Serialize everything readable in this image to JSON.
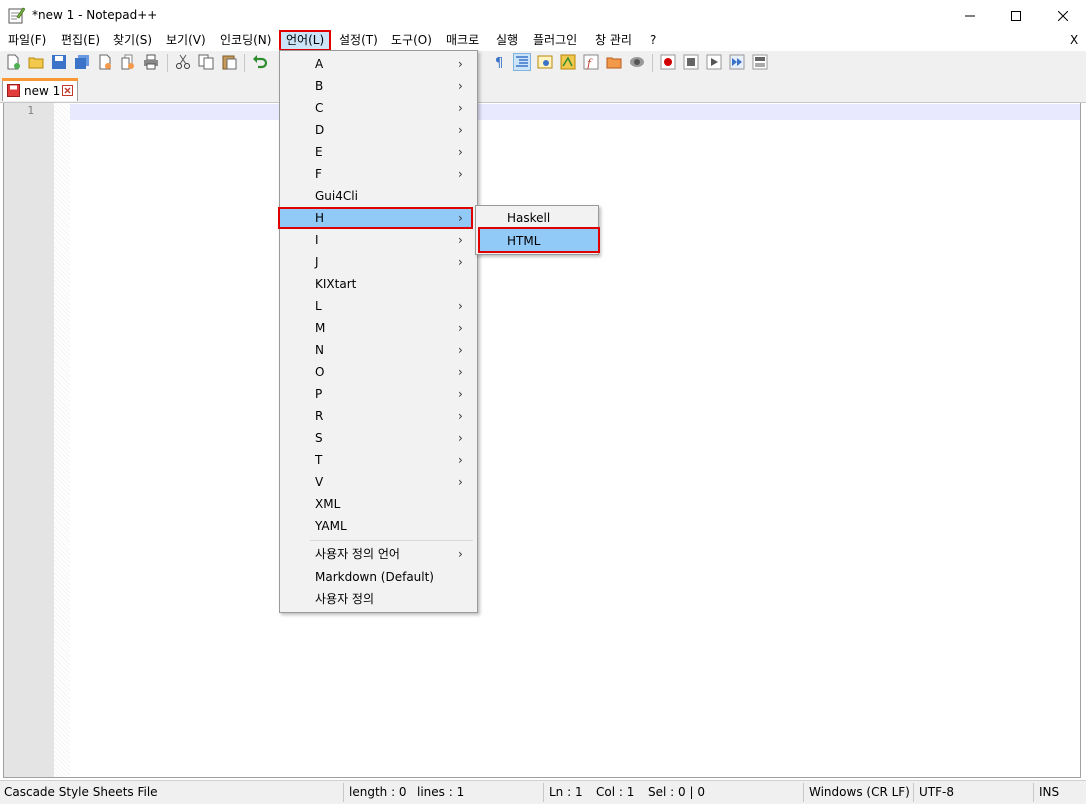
{
  "window": {
    "title": "*new 1 - Notepad++",
    "minimize_glyph": "—",
    "maximize_glyph": "☐",
    "close_glyph": "✕"
  },
  "menubar": {
    "items": [
      "파일(F)",
      "편집(E)",
      "찾기(S)",
      "보기(V)",
      "인코딩(N)",
      "언어(L)",
      "설정(T)",
      "도구(O)",
      "매크로",
      "실행",
      "플러그인",
      "창 관리",
      "?"
    ],
    "close_x": "X"
  },
  "tabs": [
    {
      "label": "new 1",
      "close_glyph": "✕"
    }
  ],
  "editor": {
    "line_numbers": [
      "1"
    ]
  },
  "language_menu": {
    "items": [
      {
        "label": "A",
        "submenu": true
      },
      {
        "label": "B",
        "submenu": true
      },
      {
        "label": "C",
        "submenu": true
      },
      {
        "label": "D",
        "submenu": true
      },
      {
        "label": "E",
        "submenu": true
      },
      {
        "label": "F",
        "submenu": true
      },
      {
        "label": "Gui4Cli",
        "submenu": false
      },
      {
        "label": "H",
        "submenu": true,
        "highlighted": true
      },
      {
        "label": "I",
        "submenu": true
      },
      {
        "label": "J",
        "submenu": true
      },
      {
        "label": "KIXtart",
        "submenu": false
      },
      {
        "label": "L",
        "submenu": true
      },
      {
        "label": "M",
        "submenu": true
      },
      {
        "label": "N",
        "submenu": true
      },
      {
        "label": "O",
        "submenu": true
      },
      {
        "label": "P",
        "submenu": true
      },
      {
        "label": "R",
        "submenu": true
      },
      {
        "label": "S",
        "submenu": true
      },
      {
        "label": "T",
        "submenu": true
      },
      {
        "label": "V",
        "submenu": true
      },
      {
        "label": "XML",
        "submenu": false
      },
      {
        "label": "YAML",
        "submenu": false
      }
    ],
    "user_defined_language": "사용자 정의 언어",
    "markdown": "Markdown (Default)",
    "user_defined": "사용자 정의",
    "arrow_glyph": "›"
  },
  "h_submenu": {
    "items": [
      "Haskell",
      "HTML"
    ]
  },
  "statusbar": {
    "file_type": "Cascade Style Sheets File",
    "length": "length : 0",
    "lines": "lines : 1",
    "ln": "Ln : 1",
    "col": "Col : 1",
    "sel": "Sel : 0 | 0",
    "eol": "Windows (CR LF)",
    "encoding": "UTF-8",
    "mode": "INS"
  },
  "colors": {
    "highlight": "#91c9f7",
    "annotation_red": "#e00000",
    "tab_accent": "#fa9838",
    "caret_line": "#e8e8ff"
  }
}
